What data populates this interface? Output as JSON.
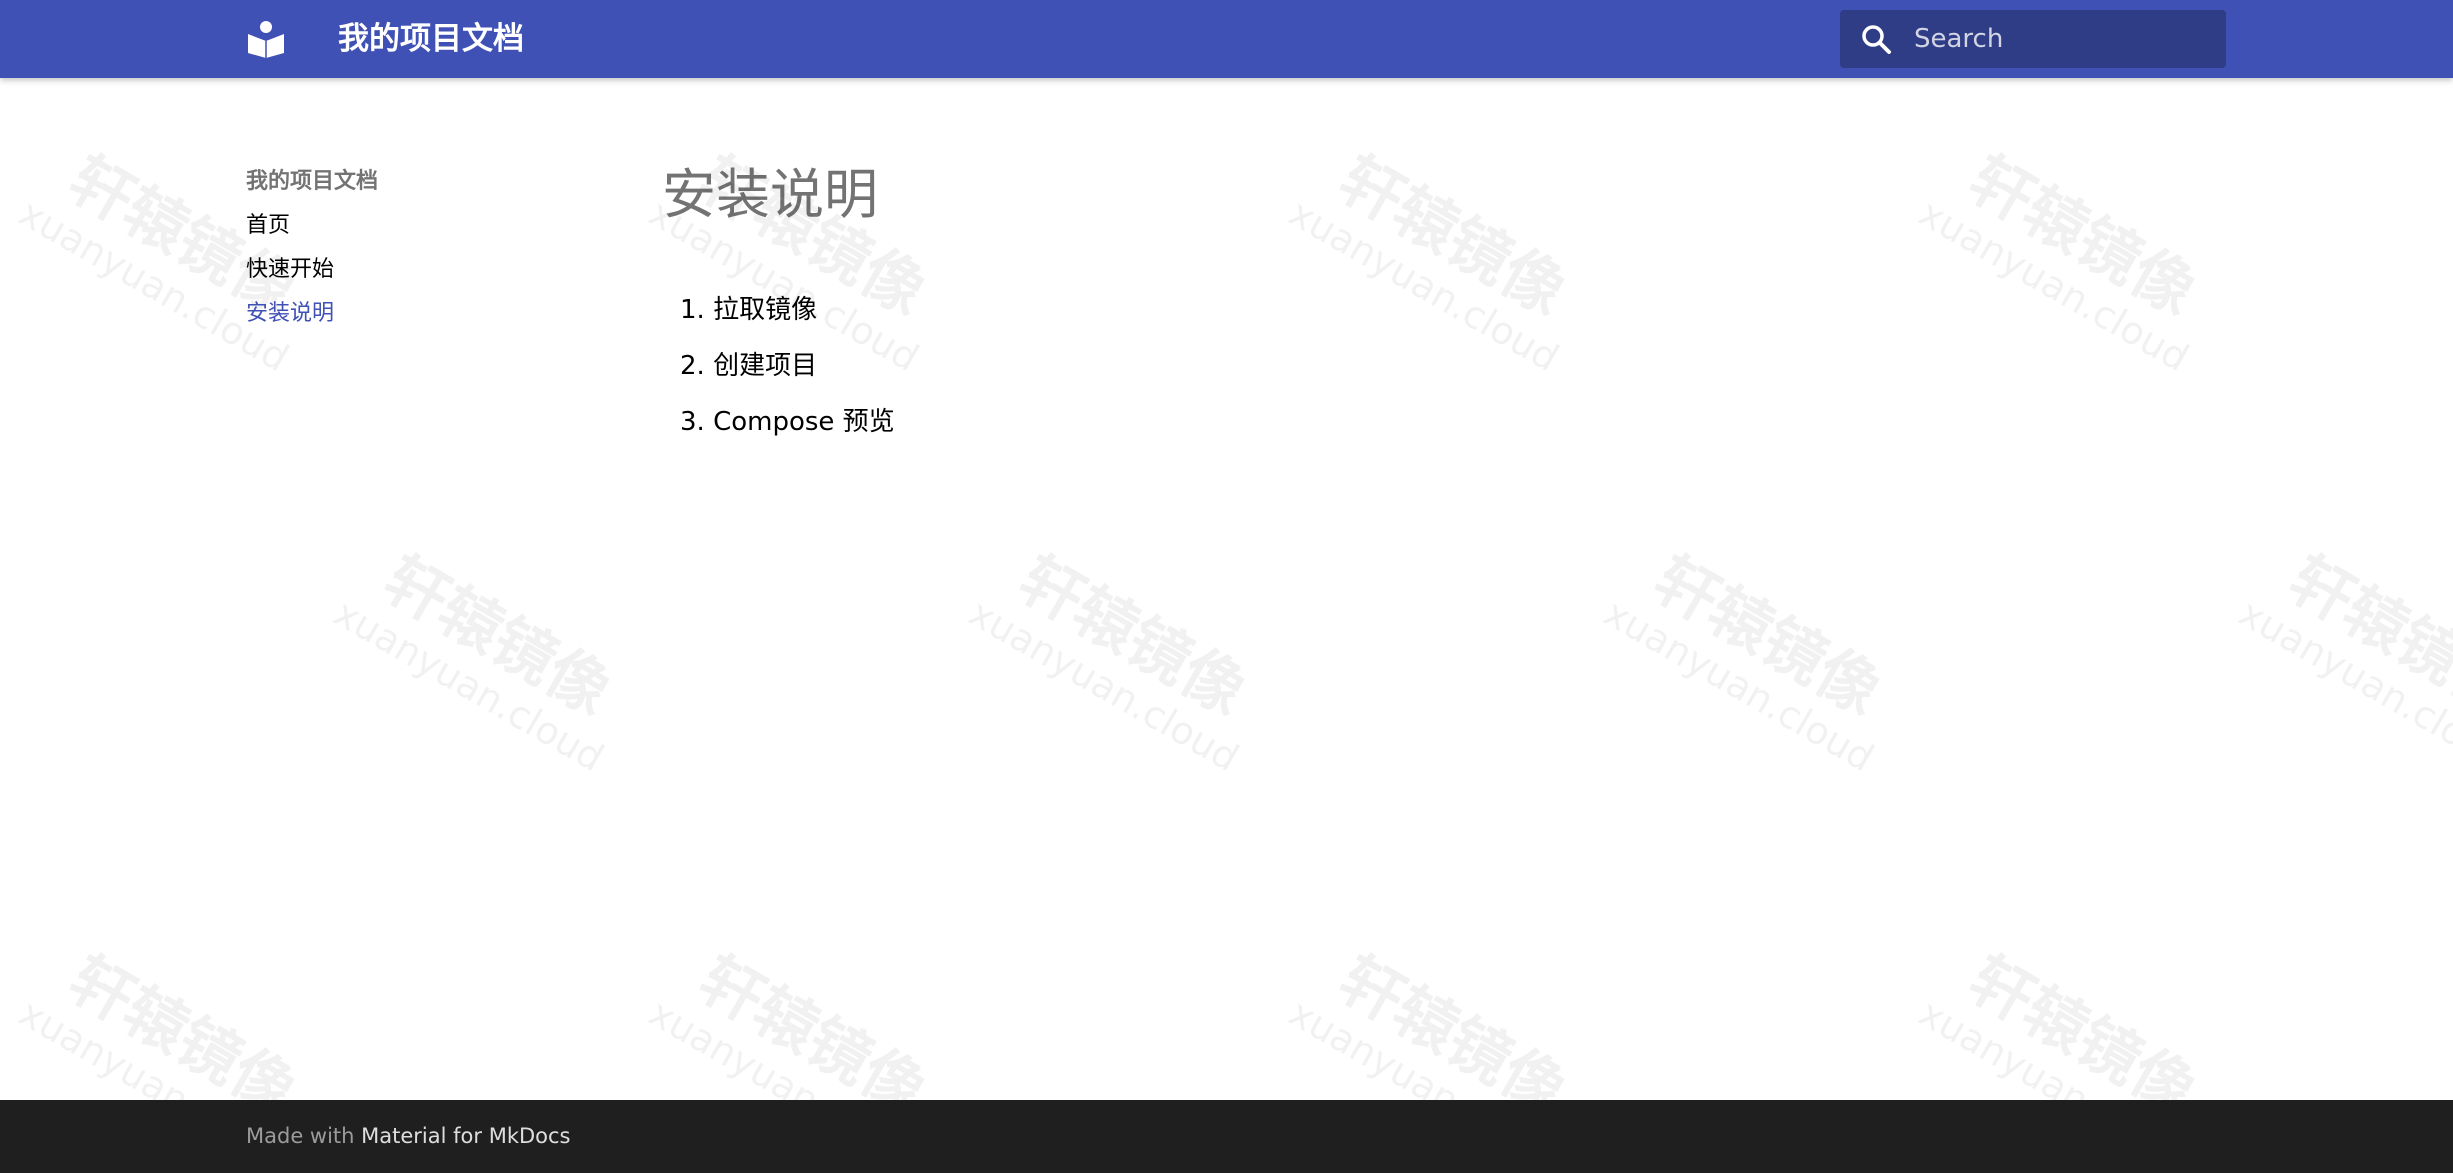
{
  "header": {
    "logo_icon": "book-reader-icon",
    "site_title": "我的项目文档",
    "search": {
      "icon": "search-icon",
      "placeholder": "Search"
    }
  },
  "watermark": {
    "text_cn": "轩辕镜像",
    "text_en": "xuanyuan.cloud"
  },
  "sidebar": {
    "title": "我的项目文档",
    "items": [
      {
        "label": "首页"
      },
      {
        "label": "快速开始"
      },
      {
        "label": "安装说明",
        "active": true
      }
    ]
  },
  "main": {
    "title": "安装说明",
    "steps": [
      {
        "number": "1.",
        "text": "拉取镜像"
      },
      {
        "number": "2.",
        "text": "创建项目"
      },
      {
        "number": "3.",
        "text": "Compose 预览"
      }
    ]
  },
  "footer": {
    "prefix": "Made with",
    "link_label": "Material for MkDocs"
  },
  "colors": {
    "primary": "#4051b5",
    "footer_bg": "#1f1f1f",
    "active_link": "#4051b5"
  }
}
